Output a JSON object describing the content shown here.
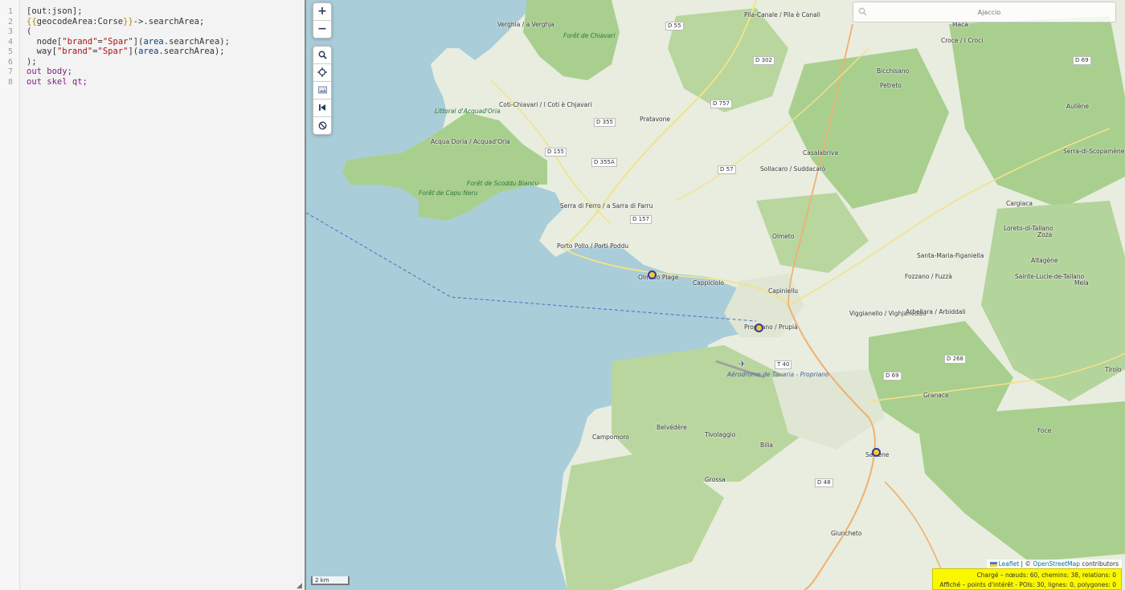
{
  "editor": {
    "line_numbers": [
      "1",
      "2",
      "3",
      "4",
      "5",
      "6",
      "7",
      "8"
    ],
    "lines": {
      "l1": "[out:json];",
      "l2_a": "{{",
      "l2_b": "geocodeArea:Corse",
      "l2_c": "}}",
      "l2_d": "->.searchArea;",
      "l3": "(",
      "l4_a": "  node[",
      "l4_b": "\"brand\"",
      "l4_c": "=",
      "l4_d": "\"Spar\"",
      "l4_e": "](",
      "l4_f": "area",
      "l4_g": ".searchArea);",
      "l5_a": "  way[",
      "l5_b": "\"brand\"",
      "l5_c": "=",
      "l5_d": "\"Spar\"",
      "l5_e": "](",
      "l5_f": "area",
      "l5_g": ".searchArea);",
      "l6": ");",
      "l7": "out body;",
      "l8": "out skel qt;"
    }
  },
  "map": {
    "controls": {
      "zoom_in": "+",
      "zoom_out": "−"
    },
    "search": {
      "placeholder": "Ajaccio"
    },
    "scale_label": "2 km",
    "attribution": {
      "leaflet": "Leaflet",
      "sep": " | © ",
      "osm": "OpenStreetMap",
      "contrib": " contributors"
    },
    "status": {
      "line1": "Chargé – nœuds: 60, chemins: 38, relations: 0",
      "line2": "Affiché – points d'intérêt - POIs: 30, lignes: 0, polygones: 0"
    },
    "colors": {
      "sea": "#a9cdd9",
      "land": "#e8eddf",
      "forest": "#a8cf8e",
      "status_bg": "#fbf700"
    },
    "places": {
      "verghia": "Verghia / a Verghja",
      "pila": "Pila-Canale / Pila è Canali",
      "maca": "Maca",
      "croce": "Croce / I Croci",
      "foret_chiavari": "Forêt de Chiavari",
      "coti": "Coti-Chiavari / I Coti è Chjavari",
      "littoral": "Littoral d'Acquad'Oria",
      "acqua": "Acqua Doria / Acquad'Oria",
      "foret_scoddu": "Forêt de Scoddu Biancu",
      "foret_capu": "Forêt de Capu Neru",
      "pratavone": "Pratavone",
      "bicchisano": "Bicchisano",
      "petreto": "Petreto",
      "aullene": "Aullène",
      "serra_scop": "Serra-di-Scopamène",
      "casalabriva": "Casalabriva",
      "sollacaro": "Sollacaro / Suddacarò",
      "serra_ferro": "Serra di Ferro / a Sarra di Farru",
      "porto_pollo": "Porto Pollo / Porti Poddu",
      "olmeto_plage": "Olmeto Plage",
      "cappiciolo": "Cappiciolo",
      "capiniellu": "Capiniellu",
      "olmeto": "Olmeto",
      "cargiaca": "Cargiaca",
      "loreto": "Loreto-di-Tallano",
      "zoza": "Zoza",
      "altagene": "Altagène",
      "santa_maria": "Santa-Maria-Figaniella",
      "fozzano": "Fozzano / Fuzzà",
      "sainte_lucie": "Sainte-Lucie-de-Tallano",
      "mela": "Mela",
      "viggianello": "Viggianello / Vighjaneddu",
      "arbellara": "Arbellara / Arbiddali",
      "propriano": "Propriano / Prupià",
      "aerodrome": "Aérodrome de Tavaria - Propriano",
      "granace": "Granace",
      "tirolo": "Tirolo",
      "belvedere": "Belvédère",
      "campomoro": "Campomoro",
      "tivolaggio": "Tivolaggio",
      "bilia": "Bilia",
      "sartene": "Sartène",
      "foce": "Foce",
      "grossa": "Grossa",
      "giuncheto": "Giuncheto"
    },
    "roads": [
      "D 55",
      "D 302",
      "D 69",
      "D 757",
      "D 355",
      "D 155",
      "D 355A",
      "D 57",
      "D 157",
      "D 268",
      "T 40",
      "D 69",
      "D 48"
    ]
  }
}
